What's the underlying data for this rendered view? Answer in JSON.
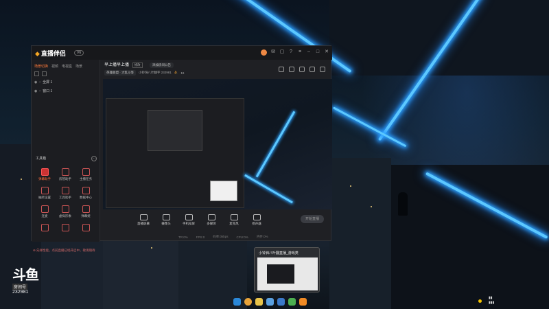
{
  "app": {
    "name": "直播伴侣",
    "version_badge": "V6",
    "title_icons": [
      "avatar-icon",
      "mail-icon",
      "message-icon",
      "help-icon",
      "menu-icon",
      "minimize-icon",
      "maximize-icon",
      "close-icon"
    ]
  },
  "left": {
    "tabs": [
      "场景切换",
      "视频",
      "电视盒",
      "场景"
    ],
    "active_tab": 0,
    "sources": [
      {
        "icon": "eye-icon",
        "label": "全屏 1"
      },
      {
        "icon": "eye-icon",
        "label": "窗口 1"
      }
    ],
    "toolbox_title": "工具箱",
    "tools": [
      {
        "label": "弹幕助手",
        "active": true
      },
      {
        "label": "房管助手",
        "active": false
      },
      {
        "label": "主播任务",
        "active": false
      },
      {
        "label": "抽奖设置",
        "active": false
      },
      {
        "label": "工具助手",
        "active": false
      },
      {
        "label": "数据中心",
        "active": false
      },
      {
        "label": "连麦",
        "active": false
      },
      {
        "label": "虚拟形象",
        "active": false
      },
      {
        "label": "弹幕姬",
        "active": false
      },
      {
        "label": "",
        "active": false
      },
      {
        "label": "",
        "active": false
      },
      {
        "label": "",
        "active": false
      }
    ],
    "tip": "⊕ 先择性能。点前直播已经开启中，敬请期待"
  },
  "room": {
    "title": "早上播早上播",
    "edit_label": "修改",
    "announcement": "添加房间公告",
    "category": "英雄联盟 · 大乱斗等",
    "meta": "小铃铛八叶翻字 232981",
    "viewers": "19"
  },
  "controls": {
    "buttons": [
      "直播屏幕",
      "摄像头",
      "手机投屏",
      "多媒体",
      "麦克风",
      "扬声器"
    ],
    "start_label": "开始直播",
    "status": [
      "TR:0%",
      "FPS:0",
      "码率:0kbps",
      "CPU:0%",
      "内存:0%"
    ]
  },
  "taskbar": {
    "preview_title": "小铃铛八叶翻直播_游戏类"
  },
  "overlay": {
    "logo": "斗鱼",
    "room_label": "房间号",
    "room_number": "232981"
  }
}
